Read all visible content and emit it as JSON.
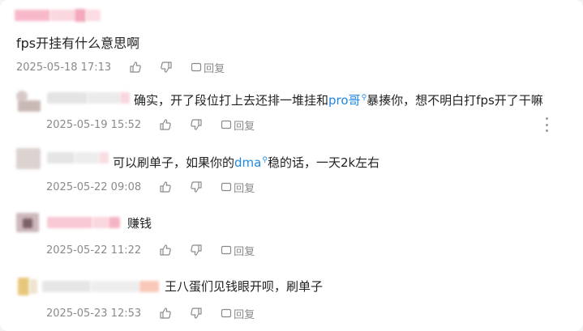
{
  "comment": {
    "text": "fps开挂有什么意思啊",
    "time": "2025-05-18 17:13",
    "reply_label": "回复"
  },
  "replies": [
    {
      "text_parts": [
        "确实，开了段位打上去还排一堆挂和",
        "pro哥",
        "暴揍你，想不明白打fps开了干嘛"
      ],
      "time": "2025-05-19 15:52",
      "reply_label": "回复"
    },
    {
      "text_parts": [
        "可以刷单子，如果你的",
        "dma",
        "稳的话，一天2k左右"
      ],
      "time": "2025-05-22 09:08",
      "reply_label": "回复"
    },
    {
      "text": "赚钱",
      "time": "2025-05-22 11:22",
      "reply_label": "回复"
    },
    {
      "text": "王八蛋们见钱眼开呗，刷单子",
      "time": "2025-05-23 12:53",
      "reply_label": "回复"
    }
  ],
  "icons": {
    "like": "thumbs-up-icon",
    "dislike": "thumbs-down-icon",
    "reply": "reply-icon",
    "more": "more-vertical-icon",
    "search_hint": "search-icon"
  },
  "colors": {
    "text": "#222222",
    "meta": "#8a8a8a",
    "keyword": "#1e88e5"
  }
}
